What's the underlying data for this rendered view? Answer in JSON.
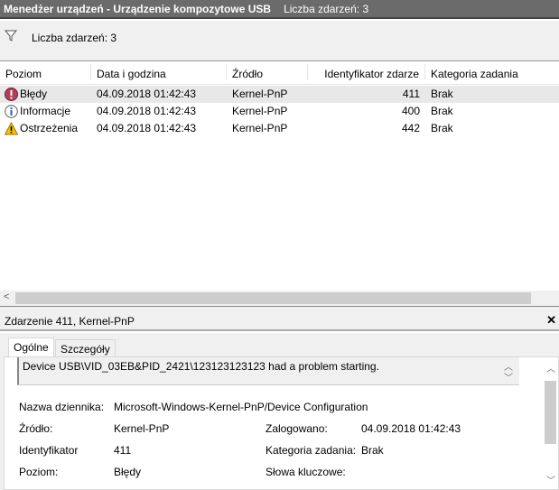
{
  "title": {
    "main": "Menedżer urządzeń - Urządzenie kompozytowe USB",
    "count": "Liczba zdarzeń: 3"
  },
  "filter": {
    "label": "Liczba zdarzeń: 3"
  },
  "columns": [
    "Poziom",
    "Data i godzina",
    "Źródło",
    "Identyfikator zdarze",
    "Kategoria zadania"
  ],
  "rows": [
    {
      "level": "Błędy",
      "icon": "error-icon",
      "date": "04.09.2018 01:42:43",
      "source": "Kernel-PnP",
      "id": "411",
      "category": "Brak"
    },
    {
      "level": "Informacje",
      "icon": "info-icon",
      "date": "04.09.2018 01:42:43",
      "source": "Kernel-PnP",
      "id": "400",
      "category": "Brak"
    },
    {
      "level": "Ostrzeżenia",
      "icon": "warning-icon",
      "date": "04.09.2018 01:42:43",
      "source": "Kernel-PnP",
      "id": "442",
      "category": "Brak"
    }
  ],
  "details": {
    "header": "Zdarzenie 411, Kernel-PnP",
    "tabs": [
      "Ogólne",
      "Szczegóły"
    ],
    "message": "Device USB\\VID_03EB&PID_2421\\123123123123 had a problem starting.",
    "log_name_label": "Nazwa dziennika:",
    "log_name": "Microsoft-Windows-Kernel-PnP/Device Configuration",
    "source_label": "Źródło:",
    "source": "Kernel-PnP",
    "logged_label": "Zalogowano:",
    "logged": "04.09.2018 01:42:43",
    "id_label": "Identyfikator",
    "id": "411",
    "category_label": "Kategoria zadania:",
    "category": "Brak",
    "level_label": "Poziom:",
    "level": "Błędy",
    "keywords_label": "Słowa kluczowe:"
  }
}
